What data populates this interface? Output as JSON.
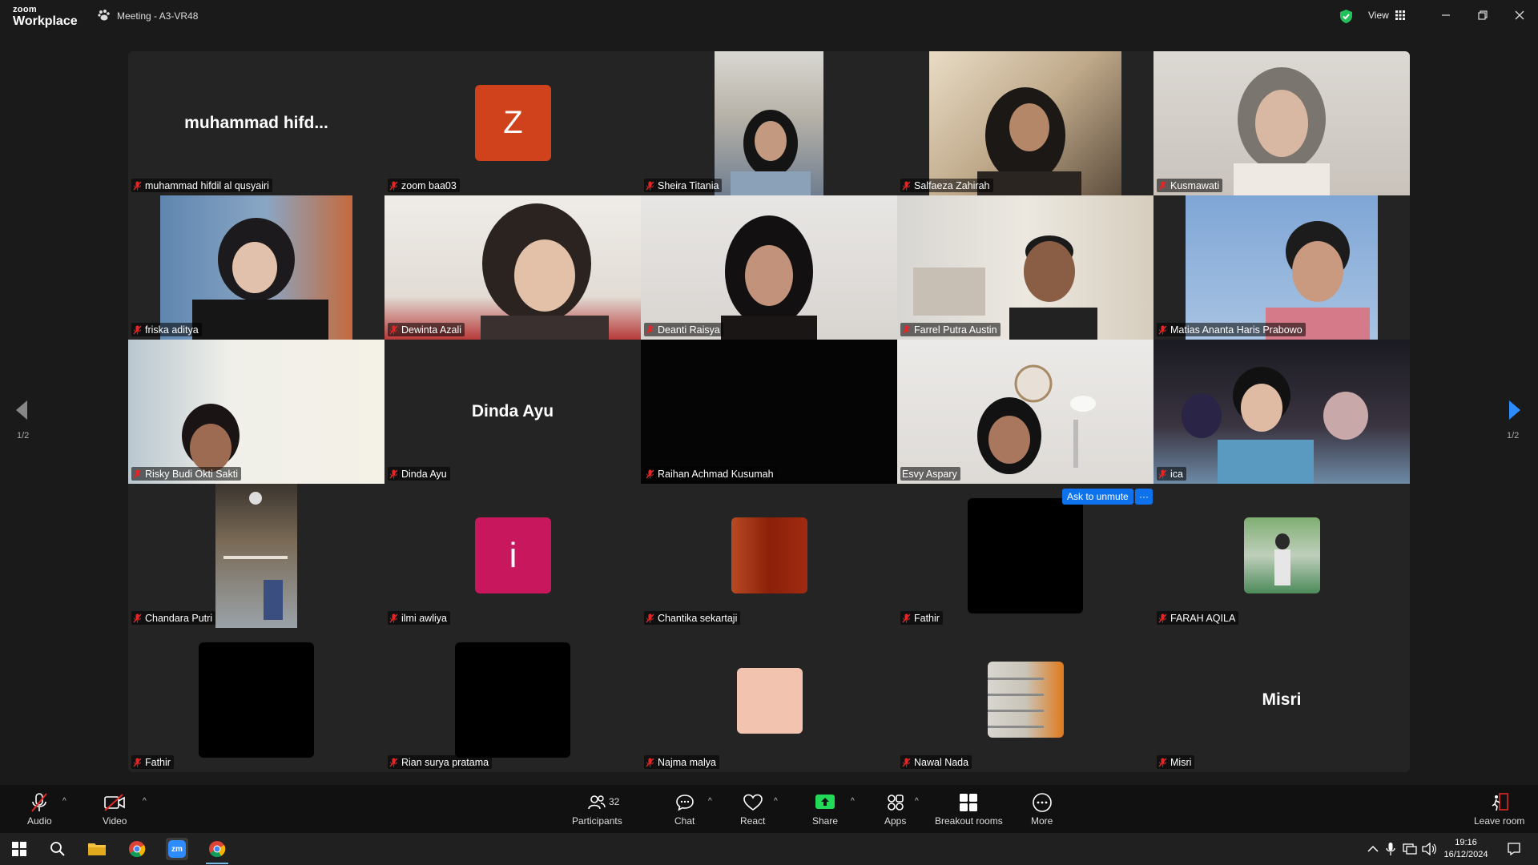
{
  "titlebar": {
    "logo_line1": "zoom",
    "logo_line2": "Workplace",
    "meeting_title": "Meeting - A3-VR48",
    "view_label": "View"
  },
  "pagination": {
    "left": "1/2",
    "right": "1/2"
  },
  "tiles": [
    {
      "name": "muhammad hifdil al qusyairi",
      "display": "muhammad  hifd..."
    },
    {
      "name": "zoom baa03",
      "avatar_letter": "Z",
      "avatar_color": "#d0421b"
    },
    {
      "name": "Sheira Titania"
    },
    {
      "name": "Salfaeza Zahirah"
    },
    {
      "name": "Kusmawati"
    },
    {
      "name": "friska aditya"
    },
    {
      "name": "Dewinta Azali"
    },
    {
      "name": "Deanti Raisya"
    },
    {
      "name": "Farrel Putra Austin"
    },
    {
      "name": "Matias Ananta Haris Prabowo"
    },
    {
      "name": "Risky Budi Okti Sakti"
    },
    {
      "name": "Dinda Ayu",
      "display": "Dinda Ayu"
    },
    {
      "name": "Raihan Achmad Kusumah"
    },
    {
      "name": "Esvy Aspary",
      "speaking": true
    },
    {
      "name": "ica"
    },
    {
      "name": "Chandara Putri"
    },
    {
      "name": "ilmi awliya",
      "avatar_letter": "i",
      "avatar_color": "#c8175d"
    },
    {
      "name": "Chantika sekartaji"
    },
    {
      "name": "Fathir"
    },
    {
      "name": "FARAH AQILA"
    },
    {
      "name": "Fathir"
    },
    {
      "name": "Rian surya pratama"
    },
    {
      "name": "Najma malya"
    },
    {
      "name": "Nawal Nada"
    },
    {
      "name": "Misri",
      "display": "Misri"
    }
  ],
  "speaker_controls": {
    "ask_to_unmute": "Ask to unmute",
    "more": "···"
  },
  "toolbar": {
    "audio": "Audio",
    "video": "Video",
    "participants": "Participants",
    "participants_count": "32",
    "chat": "Chat",
    "react": "React",
    "share": "Share",
    "apps": "Apps",
    "breakout": "Breakout rooms",
    "more": "More",
    "leave": "Leave room",
    "caret": "^"
  },
  "taskbar": {
    "time": "19:16",
    "date": "16/12/2024",
    "zoom_label": "zm"
  },
  "colors": {
    "accent_blue": "#0e72ed",
    "speaking_green": "#2ec56a",
    "share_green": "#23d959",
    "muted_red": "#e02828"
  }
}
